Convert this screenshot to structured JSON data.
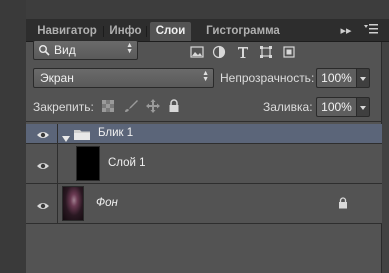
{
  "tabs": [
    "Навигатор",
    "Инфо",
    "Слои",
    "Гистограмма"
  ],
  "filter": {
    "value": "Вид"
  },
  "blend_mode": "Экран",
  "opacity": {
    "label": "Непрозрачность:",
    "value": "100%"
  },
  "lock": {
    "label": "Закрепить:"
  },
  "fill": {
    "label": "Заливка:",
    "value": "100%"
  },
  "layers": [
    {
      "name": "Блик 1",
      "type": "group",
      "expanded": true,
      "selected": true
    },
    {
      "name": "Слой 1",
      "type": "layer",
      "thumbnail": "black"
    },
    {
      "name": "Фон",
      "type": "background",
      "locked": true
    }
  ],
  "icons": [
    "eye-icon",
    "folder-icon",
    "lock-icon",
    "search-icon",
    "image-filter-icon",
    "adjustment-filter-icon",
    "type-filter-icon",
    "shape-filter-icon",
    "smart-object-filter-icon",
    "panel-menu-icon"
  ]
}
